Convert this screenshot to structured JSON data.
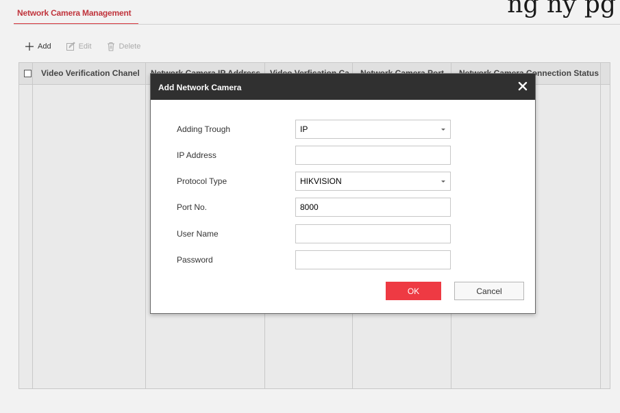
{
  "page": {
    "clipped_heading": "ng ny pg"
  },
  "tab": {
    "label": "Network Camera Management"
  },
  "toolbar": {
    "add_label": "Add",
    "edit_label": "Edit",
    "delete_label": "Delete"
  },
  "table": {
    "columns": [
      "Video Verification Chanel",
      "Network Camera IP Address",
      "Video Verfication Ca",
      "Network Camera Port",
      "Network Camera Connection Status"
    ]
  },
  "modal": {
    "title": "Add Network Camera",
    "fields": [
      {
        "label": "Adding Trough",
        "value": "IP",
        "kind": "select"
      },
      {
        "label": "IP Address",
        "value": "",
        "kind": "text"
      },
      {
        "label": "Protocol Type",
        "value": "HIKVISION",
        "kind": "select"
      },
      {
        "label": "Port No.",
        "value": "8000",
        "kind": "text"
      },
      {
        "label": "User Name",
        "value": "",
        "kind": "text"
      },
      {
        "label": "Password",
        "value": "",
        "kind": "password"
      }
    ],
    "ok_label": "OK",
    "cancel_label": "Cancel"
  },
  "colors": {
    "accent_red": "#ee3a43",
    "tab_red": "#c0343c",
    "modal_header": "#303030"
  },
  "icons": [
    "plus-icon",
    "edit-icon",
    "trash-icon",
    "close-icon",
    "chevron-down-icon"
  ]
}
